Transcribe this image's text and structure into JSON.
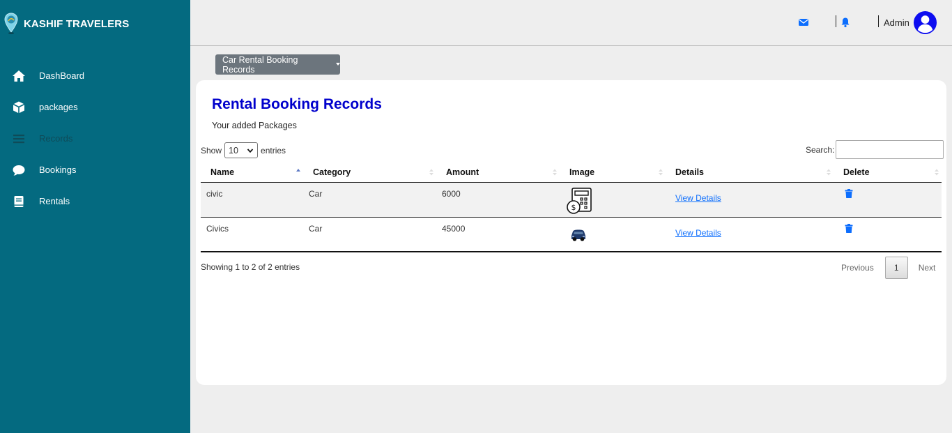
{
  "brand": {
    "title": "KASHIF TRAVELERS",
    "icon": "map-pin-icon"
  },
  "sidebar": {
    "items": [
      {
        "label": "DashBoard",
        "icon": "home-icon"
      },
      {
        "label": "packages",
        "icon": "box-icon"
      },
      {
        "label": "Records",
        "icon": "menu-icon"
      },
      {
        "label": "Bookings",
        "icon": "chat-icon"
      },
      {
        "label": "Rentals",
        "icon": "book-icon"
      }
    ]
  },
  "topbar": {
    "admin_label": "Admin"
  },
  "records_dropdown": {
    "label": "Car Rental Booking Records"
  },
  "card": {
    "title": "Rental Booking Records",
    "subtitle": "Your added Packages"
  },
  "table_controls": {
    "show_label": "Show",
    "page_length": "10",
    "entries_label": "entries",
    "search_label": "Search:",
    "search_value": ""
  },
  "table": {
    "columns": [
      "Name",
      "Category",
      "Amount",
      "Image",
      "Details",
      "Delete"
    ],
    "rows": [
      {
        "name": "civic",
        "category": "Car",
        "amount": "6000",
        "image": "calculator-dollar-icon",
        "details": "View Details"
      },
      {
        "name": "Civics",
        "category": "Car",
        "amount": "45000",
        "image": "car-photo",
        "details": "View Details"
      }
    ]
  },
  "table_info": "Showing 1 to 2 of 2 entries",
  "pagination": {
    "previous": "Previous",
    "current": "1",
    "next": "Next"
  },
  "colors": {
    "sidebar": "#046a80",
    "accent": "#0d6efd",
    "title": "#0000cc",
    "button": "#6c757d"
  }
}
